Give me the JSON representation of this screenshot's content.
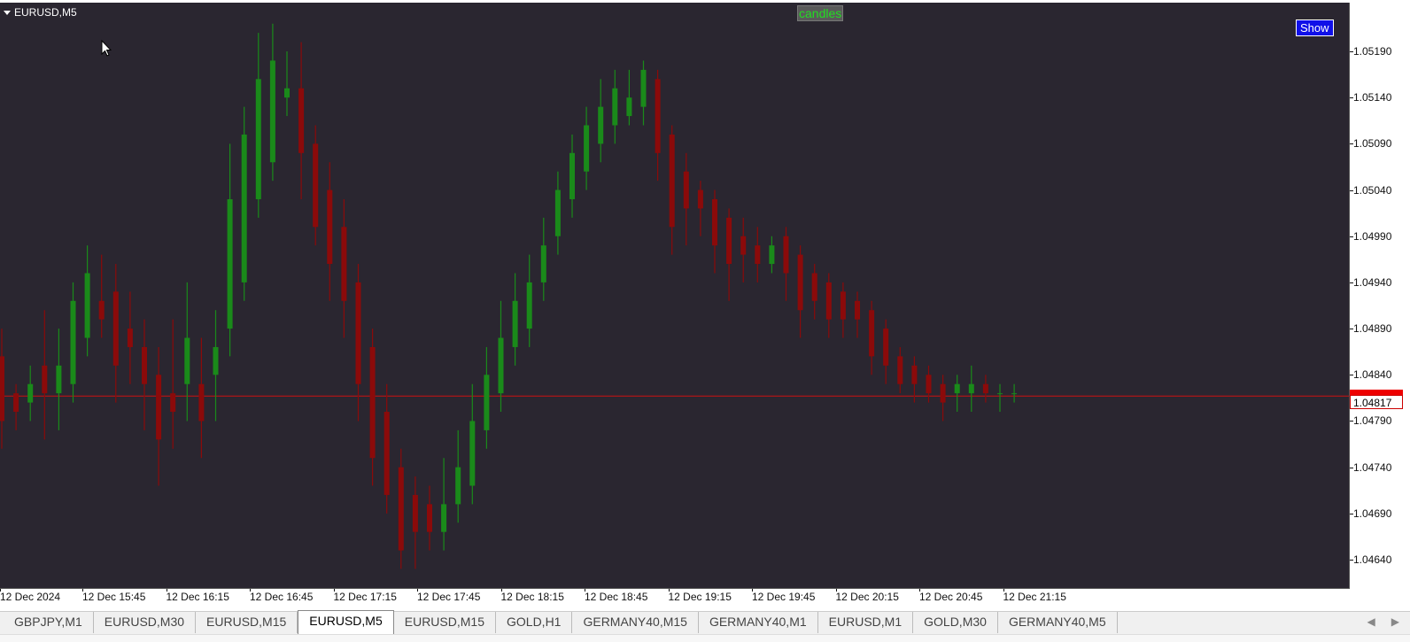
{
  "chart": {
    "symbol_title": "EURUSD,M5",
    "candles_label": "candles",
    "show_button": "Show",
    "bid_price": "1.04817",
    "colors": {
      "background": "#2a2630",
      "bull": "#1a8a1a",
      "bear": "#8b0a0a",
      "bid_line": "#cc1111"
    }
  },
  "price_axis": {
    "ticks": [
      "1.05190",
      "1.05140",
      "1.05090",
      "1.05040",
      "1.04990",
      "1.04940",
      "1.04890",
      "1.04840",
      "1.04790",
      "1.04740",
      "1.04690",
      "1.04640"
    ]
  },
  "time_axis": {
    "ticks": [
      "12 Dec 2024",
      "12 Dec 15:45",
      "12 Dec 16:15",
      "12 Dec 16:45",
      "12 Dec 17:15",
      "12 Dec 17:45",
      "12 Dec 18:15",
      "12 Dec 18:45",
      "12 Dec 19:15",
      "12 Dec 19:45",
      "12 Dec 20:15",
      "12 Dec 20:45",
      "12 Dec 21:15"
    ]
  },
  "tabs": [
    {
      "label": "GBPJPY,M1",
      "active": false
    },
    {
      "label": "EURUSD,M30",
      "active": false
    },
    {
      "label": "EURUSD,M15",
      "active": false
    },
    {
      "label": "EURUSD,M5",
      "active": true
    },
    {
      "label": "EURUSD,M15",
      "active": false
    },
    {
      "label": "GOLD,H1",
      "active": false
    },
    {
      "label": "GERMANY40,M15",
      "active": false
    },
    {
      "label": "GERMANY40,M1",
      "active": false
    },
    {
      "label": "EURUSD,M1",
      "active": false
    },
    {
      "label": "GOLD,M30",
      "active": false
    },
    {
      "label": "GERMANY40,M5",
      "active": false
    }
  ],
  "chart_data": {
    "type": "candlestick",
    "title": "EURUSD,M5",
    "ylim": [
      1.0462,
      1.0524
    ],
    "candles": [
      [
        1.0486,
        1.0489,
        1.0476,
        1.0479
      ],
      [
        1.0482,
        1.0483,
        1.0478,
        1.048
      ],
      [
        1.0481,
        1.0485,
        1.0479,
        1.0483
      ],
      [
        1.0485,
        1.0491,
        1.0477,
        1.0482
      ],
      [
        1.0482,
        1.0489,
        1.0478,
        1.0485
      ],
      [
        1.0483,
        1.0494,
        1.0481,
        1.0492
      ],
      [
        1.0488,
        1.0498,
        1.0486,
        1.0495
      ],
      [
        1.0492,
        1.0497,
        1.0488,
        1.049
      ],
      [
        1.0493,
        1.0496,
        1.0481,
        1.0485
      ],
      [
        1.0489,
        1.0493,
        1.0483,
        1.0487
      ],
      [
        1.0487,
        1.049,
        1.0478,
        1.0483
      ],
      [
        1.0484,
        1.0487,
        1.0472,
        1.0477
      ],
      [
        1.0482,
        1.049,
        1.0476,
        1.048
      ],
      [
        1.0483,
        1.0494,
        1.0479,
        1.0488
      ],
      [
        1.0483,
        1.0488,
        1.0475,
        1.0479
      ],
      [
        1.0484,
        1.0491,
        1.0479,
        1.0487
      ],
      [
        1.0489,
        1.0509,
        1.0486,
        1.0503
      ],
      [
        1.0494,
        1.0513,
        1.0492,
        1.051
      ],
      [
        1.0503,
        1.0521,
        1.0501,
        1.0516
      ],
      [
        1.0507,
        1.0522,
        1.0505,
        1.0518
      ],
      [
        1.0514,
        1.0519,
        1.0512,
        1.0515
      ],
      [
        1.0515,
        1.052,
        1.0503,
        1.0508
      ],
      [
        1.0509,
        1.0511,
        1.0498,
        1.05
      ],
      [
        1.0504,
        1.0507,
        1.0492,
        1.0496
      ],
      [
        1.05,
        1.0503,
        1.0488,
        1.0492
      ],
      [
        1.0494,
        1.0496,
        1.0479,
        1.0483
      ],
      [
        1.0487,
        1.0489,
        1.0472,
        1.0475
      ],
      [
        1.048,
        1.0483,
        1.0469,
        1.0471
      ],
      [
        1.0474,
        1.0476,
        1.0463,
        1.0465
      ],
      [
        1.0471,
        1.0473,
        1.0463,
        1.0467
      ],
      [
        1.047,
        1.0472,
        1.0465,
        1.0467
      ],
      [
        1.0467,
        1.0475,
        1.0465,
        1.047
      ],
      [
        1.047,
        1.0478,
        1.0468,
        1.0474
      ],
      [
        1.0472,
        1.0483,
        1.047,
        1.0479
      ],
      [
        1.0478,
        1.0487,
        1.0476,
        1.0484
      ],
      [
        1.0482,
        1.0492,
        1.048,
        1.0488
      ],
      [
        1.0487,
        1.0495,
        1.0485,
        1.0492
      ],
      [
        1.0489,
        1.0497,
        1.0487,
        1.0494
      ],
      [
        1.0494,
        1.0501,
        1.0492,
        1.0498
      ],
      [
        1.0499,
        1.0506,
        1.0497,
        1.0504
      ],
      [
        1.0503,
        1.051,
        1.0501,
        1.0508
      ],
      [
        1.0506,
        1.0513,
        1.0504,
        1.0511
      ],
      [
        1.0509,
        1.0516,
        1.0507,
        1.0513
      ],
      [
        1.0511,
        1.0517,
        1.0509,
        1.0515
      ],
      [
        1.0512,
        1.0517,
        1.0511,
        1.0514
      ],
      [
        1.0513,
        1.0518,
        1.0511,
        1.0517
      ],
      [
        1.0516,
        1.0517,
        1.0505,
        1.0508
      ],
      [
        1.051,
        1.0511,
        1.0497,
        1.05
      ],
      [
        1.0506,
        1.0508,
        1.0498,
        1.0502
      ],
      [
        1.0504,
        1.0505,
        1.0499,
        1.0502
      ],
      [
        1.0503,
        1.0504,
        1.0495,
        1.0498
      ],
      [
        1.0501,
        1.0502,
        1.0492,
        1.0496
      ],
      [
        1.0499,
        1.0501,
        1.0494,
        1.0497
      ],
      [
        1.0498,
        1.05,
        1.0494,
        1.0496
      ],
      [
        1.0496,
        1.0499,
        1.0495,
        1.0498
      ],
      [
        1.0499,
        1.05,
        1.0492,
        1.0495
      ],
      [
        1.0497,
        1.0498,
        1.0488,
        1.0491
      ],
      [
        1.0495,
        1.0496,
        1.049,
        1.0492
      ],
      [
        1.0494,
        1.0495,
        1.0488,
        1.049
      ],
      [
        1.0493,
        1.0494,
        1.0488,
        1.049
      ],
      [
        1.0492,
        1.0493,
        1.0488,
        1.049
      ],
      [
        1.0491,
        1.0492,
        1.0484,
        1.0486
      ],
      [
        1.0489,
        1.049,
        1.0483,
        1.0485
      ],
      [
        1.0486,
        1.0487,
        1.0482,
        1.0483
      ],
      [
        1.0485,
        1.0486,
        1.0481,
        1.0483
      ],
      [
        1.0484,
        1.0485,
        1.0481,
        1.0482
      ],
      [
        1.0483,
        1.0484,
        1.0479,
        1.0481
      ],
      [
        1.0482,
        1.0484,
        1.048,
        1.0483
      ],
      [
        1.0482,
        1.0485,
        1.048,
        1.0483
      ],
      [
        1.0483,
        1.0484,
        1.0481,
        1.0482
      ],
      [
        1.0482,
        1.0483,
        1.048,
        1.0482
      ],
      [
        1.0482,
        1.0483,
        1.0481,
        1.0482
      ]
    ]
  }
}
